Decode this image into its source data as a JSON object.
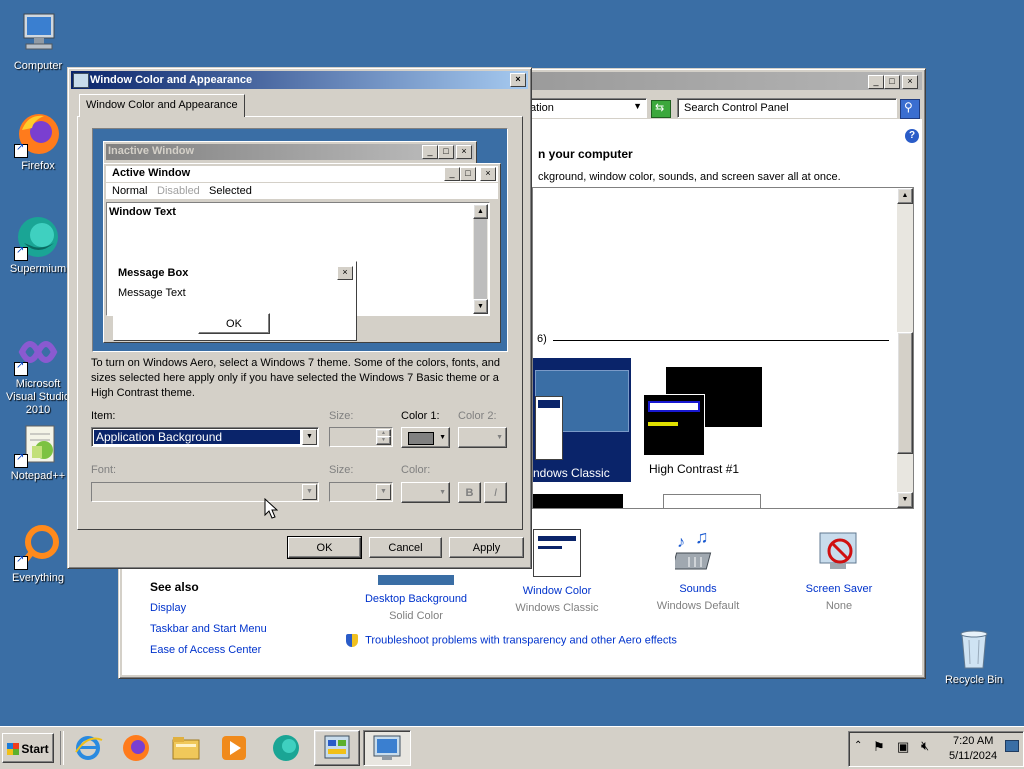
{
  "desktop": {
    "icons": [
      {
        "label": "Computer",
        "icon": "computer-icon"
      },
      {
        "label": "Firefox",
        "icon": "firefox-icon"
      },
      {
        "label": "Supermium",
        "icon": "supermium-icon"
      },
      {
        "label": "Microsoft Visual Studio 2010",
        "icon": "visual-studio-icon"
      },
      {
        "label": "Notepad++",
        "icon": "notepadpp-icon"
      },
      {
        "label": "Everything",
        "icon": "everything-icon"
      },
      {
        "label": "Recycle Bin",
        "icon": "recycle-bin-icon"
      }
    ],
    "background_color": "#3a6ea5"
  },
  "control_panel": {
    "address_fragment": "ation",
    "search_placeholder": "Search Control Panel",
    "heading_fragment": "n your computer",
    "description_fragment": "ckground, window color, sounds, and screen saver all at once.",
    "group_count_fragment": "6)",
    "themes": [
      {
        "label": "ndows Classic"
      },
      {
        "label": "High Contrast #1"
      }
    ],
    "bottom_items": [
      {
        "title": "Desktop Background",
        "subtitle": "Solid Color"
      },
      {
        "title": "Window Color",
        "subtitle": "Windows Classic"
      },
      {
        "title": "Sounds",
        "subtitle": "Windows Default"
      },
      {
        "title": "Screen Saver",
        "subtitle": "None"
      }
    ],
    "see_also": {
      "title": "See also",
      "links": [
        "Display",
        "Taskbar and Start Menu",
        "Ease of Access Center"
      ]
    },
    "troubleshoot_link": "Troubleshoot problems with transparency and other Aero effects"
  },
  "dialog": {
    "title": "Window Color and Appearance",
    "tab_label": "Window Color and Appearance",
    "preview": {
      "inactive_title": "Inactive Window",
      "active_title": "Active Window",
      "menu": [
        "Normal",
        "Disabled",
        "Selected"
      ],
      "window_text": "Window Text",
      "msgbox_title": "Message Box",
      "msgbox_text": "Message Text",
      "msgbox_ok": "OK"
    },
    "info_text": "To turn on Windows Aero, select a Windows 7 theme.  Some of the colors, fonts, and sizes selected here apply only if you have selected the Windows 7 Basic theme or a High Contrast theme.",
    "labels": {
      "item": "Item:",
      "size": "Size:",
      "color1": "Color 1:",
      "color2": "Color 2:",
      "font": "Font:",
      "size2": "Size:",
      "color": "Color:",
      "bold": "B",
      "italic": "I"
    },
    "item_value": "Application Background",
    "buttons": {
      "ok": "OK",
      "cancel": "Cancel",
      "apply": "Apply"
    }
  },
  "taskbar": {
    "start_label": "Start",
    "clock_time": "7:20 AM",
    "clock_date": "5/11/2024"
  }
}
